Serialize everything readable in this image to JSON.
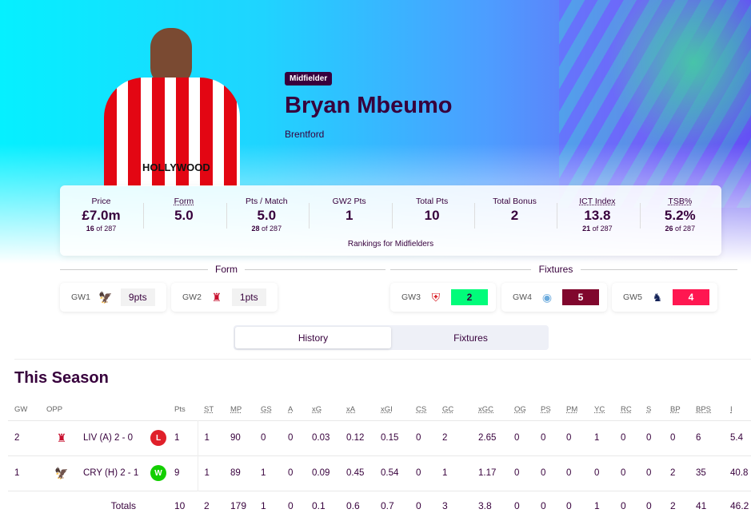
{
  "player": {
    "position": "Midfielder",
    "name": "Bryan Mbeumo",
    "club": "Brentford",
    "shirt_text": "HOLLYWOOD"
  },
  "stats": [
    {
      "label": "Price",
      "value": "£7.0m",
      "rank": "16",
      "of": "of 287"
    },
    {
      "label": "Form",
      "value": "5.0",
      "rank": "",
      "of": ""
    },
    {
      "label": "Pts / Match",
      "value": "5.0",
      "rank": "28",
      "of": "of 287"
    },
    {
      "label": "GW2 Pts",
      "value": "1",
      "rank": "",
      "of": ""
    },
    {
      "label": "Total Pts",
      "value": "10",
      "rank": "",
      "of": ""
    },
    {
      "label": "Total Bonus",
      "value": "2",
      "rank": "",
      "of": ""
    },
    {
      "label": "ICT Index",
      "value": "13.8",
      "rank": "21",
      "of": "of 287"
    },
    {
      "label": "TSB%",
      "value": "5.2%",
      "rank": "26",
      "of": "of 287"
    }
  ],
  "rankings_note": "Rankings for Midfielders",
  "form": {
    "title": "Form",
    "items": [
      {
        "gw": "GW1",
        "crest": "crystal-palace-crest",
        "pts": "9pts"
      },
      {
        "gw": "GW2",
        "crest": "liverpool-crest",
        "pts": "1pts"
      }
    ]
  },
  "fixtures": {
    "title": "Fixtures",
    "items": [
      {
        "gw": "GW3",
        "crest": "southampton-crest",
        "fdr": "2",
        "color": "#01fc7a",
        "text": "#37003c"
      },
      {
        "gw": "GW4",
        "crest": "man-city-crest",
        "fdr": "5",
        "color": "#80072d",
        "text": "#fff"
      },
      {
        "gw": "GW5",
        "crest": "tottenham-crest",
        "fdr": "4",
        "color": "#ff1751",
        "text": "#fff"
      }
    ]
  },
  "tabs": [
    "History",
    "Fixtures"
  ],
  "season": {
    "title": "This Season",
    "columns": [
      "GW",
      "OPP",
      "",
      "Pts",
      "ST",
      "MP",
      "GS",
      "A",
      "xG",
      "xA",
      "xGI",
      "CS",
      "GC",
      "xGC",
      "OG",
      "PS",
      "PM",
      "YC",
      "RC",
      "S",
      "BP",
      "BPS",
      "I"
    ],
    "rows": [
      {
        "gw": "2",
        "opp": "LIV (A) 2 - 0",
        "crest": "liverpool-crest",
        "result": "L",
        "result_color": "#e0202a",
        "vals": [
          "1",
          "1",
          "90",
          "0",
          "0",
          "0.03",
          "0.12",
          "0.15",
          "0",
          "2",
          "2.65",
          "0",
          "0",
          "0",
          "1",
          "0",
          "0",
          "0",
          "6",
          "5.4"
        ]
      },
      {
        "gw": "1",
        "opp": "CRY (H) 2 - 1",
        "crest": "crystal-palace-crest",
        "result": "W",
        "result_color": "#13cf00",
        "vals": [
          "9",
          "1",
          "89",
          "1",
          "0",
          "0.09",
          "0.45",
          "0.54",
          "0",
          "1",
          "1.17",
          "0",
          "0",
          "0",
          "0",
          "0",
          "0",
          "2",
          "35",
          "40.8"
        ]
      }
    ],
    "totals_label": "Totals",
    "totals": [
      "10",
      "2",
      "179",
      "1",
      "0",
      "0.1",
      "0.6",
      "0.7",
      "0",
      "3",
      "3.8",
      "0",
      "0",
      "0",
      "1",
      "0",
      "0",
      "2",
      "41",
      "46.2"
    ]
  }
}
